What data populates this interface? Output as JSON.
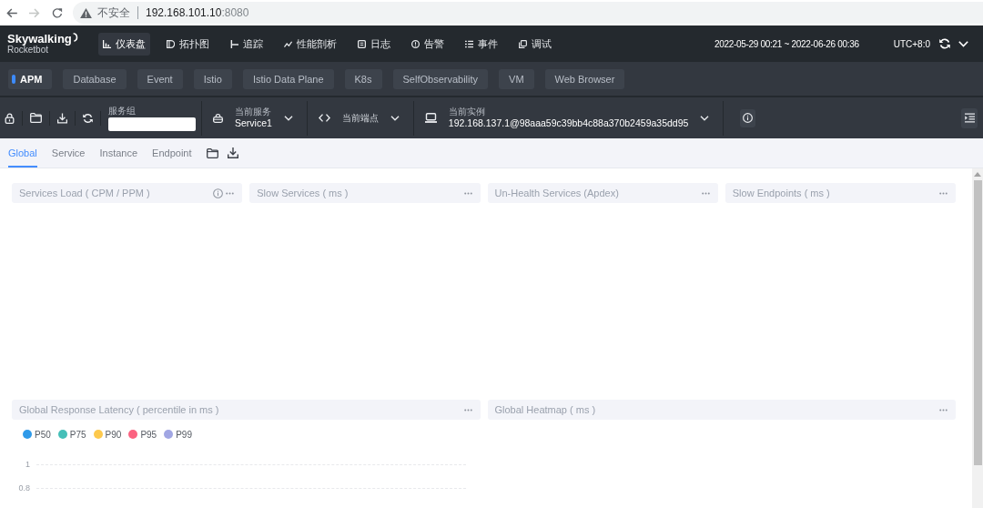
{
  "browser": {
    "nav_buttons": [
      {
        "kind": "back",
        "disabled": false
      },
      {
        "kind": "forward",
        "disabled": true
      },
      {
        "kind": "reload",
        "disabled": false
      }
    ],
    "address_bar": {
      "security_label": "不安全",
      "host": "192.168.101.10",
      "port": ":8080"
    }
  },
  "app_header": {
    "logo": {
      "name": "Skywalking",
      "subtitle": "Rocketbot"
    },
    "nav": [
      {
        "kind": "dashboard",
        "label": "仪表盘",
        "selected": true
      },
      {
        "kind": "topology",
        "label": "拓扑图",
        "selected": false
      },
      {
        "kind": "trace",
        "label": "追踪",
        "selected": false
      },
      {
        "kind": "profiling",
        "label": "性能剖析",
        "selected": false
      },
      {
        "kind": "log",
        "label": "日志",
        "selected": false
      },
      {
        "kind": "alarm",
        "label": "告警",
        "selected": false
      },
      {
        "kind": "event",
        "label": "事件",
        "selected": false
      },
      {
        "kind": "debug",
        "label": "调试",
        "selected": false
      }
    ],
    "time_range": "2022-05-29 00:21 ~ 2022-06-26 00:36",
    "timezone": "UTC+8:0"
  },
  "layers": [
    {
      "label": "APM",
      "selected": true
    },
    {
      "label": "Database",
      "selected": false
    },
    {
      "label": "Event",
      "selected": false
    },
    {
      "label": "Istio",
      "selected": false
    },
    {
      "label": "Istio Data Plane",
      "selected": false
    },
    {
      "label": "K8s",
      "selected": false
    },
    {
      "label": "SelfObservability",
      "selected": false
    },
    {
      "label": "VM",
      "selected": false
    },
    {
      "label": "Web Browser",
      "selected": false
    }
  ],
  "toolbar": {
    "service_group": {
      "label": "服务组"
    },
    "current_service": {
      "label": "当前服务",
      "value": "Service1"
    },
    "current_endpoint": {
      "label": "当前端点"
    },
    "current_instance": {
      "label": "当前实例",
      "value": "192.168.137.1@98aaa59c39bb4c88a370b2459a35dd95"
    }
  },
  "dashboard_tabs": [
    {
      "label": "Global",
      "selected": true
    },
    {
      "label": "Service",
      "selected": false
    },
    {
      "label": "Instance",
      "selected": false
    },
    {
      "label": "Endpoint",
      "selected": false
    }
  ],
  "widgets": [
    {
      "kind": "list",
      "title": "Services Load ( CPM / PPM )",
      "has_info": true
    },
    {
      "kind": "list",
      "title": "Slow Services ( ms )",
      "has_info": false
    },
    {
      "kind": "list",
      "title": "Un-Health Services (Apdex)",
      "has_info": false
    },
    {
      "kind": "list",
      "title": "Slow Endpoints ( ms )",
      "has_info": false
    },
    {
      "kind": "line",
      "title": "Global Response Latency ( percentile in ms )",
      "has_info": false,
      "legend": [
        {
          "label": "P50",
          "color": "#2f9ae9"
        },
        {
          "label": "P75",
          "color": "#45bfb8"
        },
        {
          "label": "P90",
          "color": "#fdc94d"
        },
        {
          "label": "P95",
          "color": "#fb6381"
        },
        {
          "label": "P99",
          "color": "#a1a6e3"
        }
      ],
      "y_axis_labels": [
        "1",
        "0.8"
      ]
    },
    {
      "kind": "heatmap",
      "title": "Global Heatmap ( ms )",
      "has_info": false
    }
  ]
}
